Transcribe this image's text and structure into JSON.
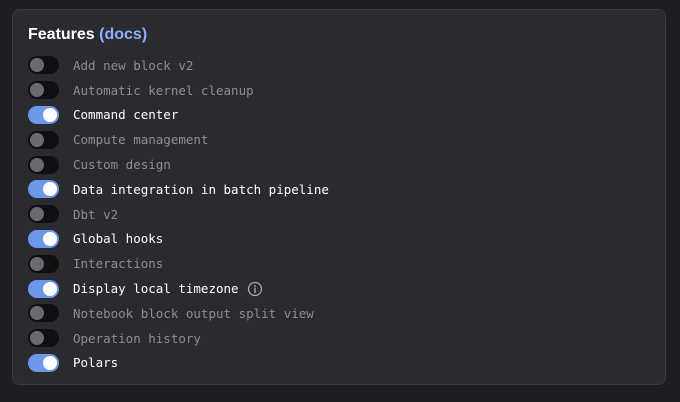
{
  "header": {
    "title": "Features",
    "docs_link": "(docs)"
  },
  "features": [
    {
      "label": "Add new block v2",
      "enabled": false
    },
    {
      "label": "Automatic kernel cleanup",
      "enabled": false
    },
    {
      "label": "Command center",
      "enabled": true
    },
    {
      "label": "Compute management",
      "enabled": false
    },
    {
      "label": "Custom design",
      "enabled": false
    },
    {
      "label": "Data integration in batch pipeline",
      "enabled": true
    },
    {
      "label": "Dbt v2",
      "enabled": false
    },
    {
      "label": "Global hooks",
      "enabled": true
    },
    {
      "label": "Interactions",
      "enabled": false
    },
    {
      "label": "Display local timezone",
      "enabled": true,
      "info_icon": "info-icon"
    },
    {
      "label": "Notebook block output split view",
      "enabled": false
    },
    {
      "label": "Operation history",
      "enabled": false
    },
    {
      "label": "Polars",
      "enabled": true
    }
  ],
  "colors": {
    "toggle_on": "#6d97e8",
    "toggle_off": "#0f1012",
    "docs_link": "#8ab0ff",
    "label_enabled": "#ffffff",
    "label_disabled": "#8d8e93"
  }
}
